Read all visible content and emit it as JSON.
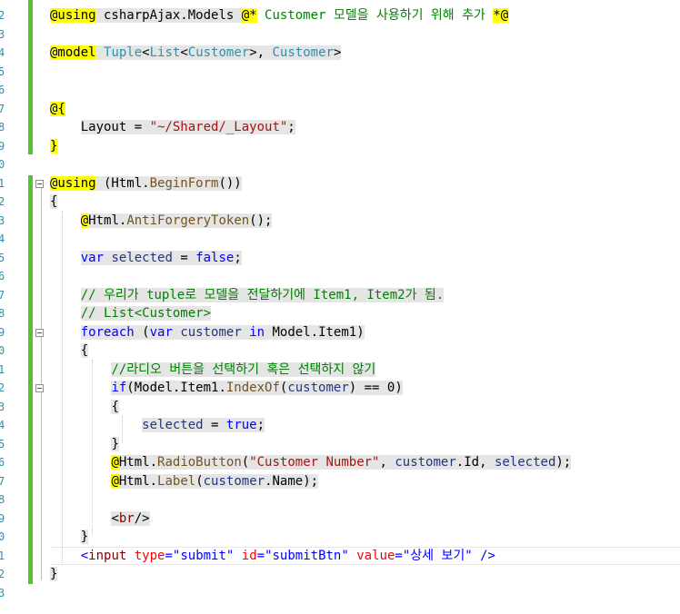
{
  "line_numbers": [
    "2",
    "3",
    "4",
    "5",
    "6",
    "7",
    "8",
    "9",
    "0",
    "1",
    "2",
    "3",
    "4",
    "5",
    "6",
    "7",
    "8",
    "9",
    "0",
    "1",
    "2",
    "3",
    "4",
    "5",
    "6",
    "7",
    "8",
    "9",
    "0",
    "1",
    "2",
    "3"
  ],
  "code_lines": [
    [
      {
        "t": "@using",
        "c": "ye at"
      },
      {
        "t": " csharpAjax.Models ",
        "c": "hl plain"
      },
      {
        "t": "@*",
        "c": "ye at"
      },
      {
        "t": " Customer 모델을 사용하기 위해 추가 ",
        "c": "cm"
      },
      {
        "t": "*@",
        "c": "ye at"
      }
    ],
    [],
    [
      {
        "t": "@model",
        "c": "ye at"
      },
      {
        "t": " ",
        "c": "hl"
      },
      {
        "t": "Tuple",
        "c": "hl ty"
      },
      {
        "t": "<",
        "c": "hl plain"
      },
      {
        "t": "List",
        "c": "hl ty"
      },
      {
        "t": "<",
        "c": "hl plain"
      },
      {
        "t": "Customer",
        "c": "hl ty"
      },
      {
        "t": ">, ",
        "c": "hl plain"
      },
      {
        "t": "Customer",
        "c": "hl ty"
      },
      {
        "t": ">",
        "c": "hl plain"
      }
    ],
    [],
    [],
    [
      {
        "t": "@{",
        "c": "ye at"
      }
    ],
    [
      {
        "t": "    ",
        "c": "plain"
      },
      {
        "t": "Layout = ",
        "c": "hl plain"
      },
      {
        "t": "\"~/Shared/_Layout\"",
        "c": "hl str"
      },
      {
        "t": ";",
        "c": "hl plain"
      }
    ],
    [
      {
        "t": "}",
        "c": "ye at"
      }
    ],
    [],
    [
      {
        "t": "@using",
        "c": "ye at"
      },
      {
        "t": " (Html.",
        "c": "hl plain"
      },
      {
        "t": "BeginForm",
        "c": "hl me"
      },
      {
        "t": "())",
        "c": "hl plain"
      }
    ],
    [
      {
        "t": "{",
        "c": "hl plain"
      }
    ],
    [
      {
        "t": "    ",
        "c": "plain"
      },
      {
        "t": "@",
        "c": "ye at"
      },
      {
        "t": "Html.",
        "c": "hl plain"
      },
      {
        "t": "AntiForgeryToken",
        "c": "hl me"
      },
      {
        "t": "();",
        "c": "hl plain"
      }
    ],
    [],
    [
      {
        "t": "    ",
        "c": "plain"
      },
      {
        "t": "var",
        "c": "hl kw"
      },
      {
        "t": " ",
        "c": "hl"
      },
      {
        "t": "selected",
        "c": "hl pr"
      },
      {
        "t": " = ",
        "c": "hl plain"
      },
      {
        "t": "false",
        "c": "hl kw"
      },
      {
        "t": ";",
        "c": "hl plain"
      }
    ],
    [],
    [
      {
        "t": "    ",
        "c": "plain"
      },
      {
        "t": "// 우리가 tuple로 모델을 전달하기에 Item1, Item2가 됨.",
        "c": "hl cm"
      }
    ],
    [
      {
        "t": "    ",
        "c": "plain"
      },
      {
        "t": "// List<Customer>",
        "c": "hl cm"
      }
    ],
    [
      {
        "t": "    ",
        "c": "plain"
      },
      {
        "t": "foreach",
        "c": "hl kw"
      },
      {
        "t": " (",
        "c": "hl plain"
      },
      {
        "t": "var",
        "c": "hl kw"
      },
      {
        "t": " ",
        "c": "hl"
      },
      {
        "t": "customer",
        "c": "hl pr"
      },
      {
        "t": " ",
        "c": "hl"
      },
      {
        "t": "in",
        "c": "hl kw"
      },
      {
        "t": " Model.Item1)",
        "c": "hl plain"
      }
    ],
    [
      {
        "t": "    ",
        "c": "plain"
      },
      {
        "t": "{",
        "c": "hl plain"
      }
    ],
    [
      {
        "t": "        ",
        "c": "plain"
      },
      {
        "t": "//라디오 버튼을 선택하기 혹은 선택하지 않기",
        "c": "hl cm"
      }
    ],
    [
      {
        "t": "        ",
        "c": "plain"
      },
      {
        "t": "if",
        "c": "hl kw"
      },
      {
        "t": "(Model.Item1.",
        "c": "hl plain"
      },
      {
        "t": "IndexOf",
        "c": "hl me"
      },
      {
        "t": "(",
        "c": "hl plain"
      },
      {
        "t": "customer",
        "c": "hl pr"
      },
      {
        "t": ") == 0)",
        "c": "hl plain"
      }
    ],
    [
      {
        "t": "        ",
        "c": "plain"
      },
      {
        "t": "{",
        "c": "hl plain"
      }
    ],
    [
      {
        "t": "            ",
        "c": "plain"
      },
      {
        "t": "selected",
        "c": "hl pr"
      },
      {
        "t": " = ",
        "c": "hl plain"
      },
      {
        "t": "true",
        "c": "hl kw"
      },
      {
        "t": ";",
        "c": "hl plain"
      }
    ],
    [
      {
        "t": "        ",
        "c": "plain"
      },
      {
        "t": "}",
        "c": "hl plain"
      }
    ],
    [
      {
        "t": "        ",
        "c": "plain"
      },
      {
        "t": "@",
        "c": "ye at"
      },
      {
        "t": "Html.",
        "c": "hl plain"
      },
      {
        "t": "RadioButton",
        "c": "hl me"
      },
      {
        "t": "(",
        "c": "hl plain"
      },
      {
        "t": "\"Customer Number\"",
        "c": "hl str"
      },
      {
        "t": ", ",
        "c": "hl plain"
      },
      {
        "t": "customer",
        "c": "hl pr"
      },
      {
        "t": ".Id, ",
        "c": "hl plain"
      },
      {
        "t": "selected",
        "c": "hl pr"
      },
      {
        "t": ");",
        "c": "hl plain"
      }
    ],
    [
      {
        "t": "        ",
        "c": "plain"
      },
      {
        "t": "@",
        "c": "ye at"
      },
      {
        "t": "Html.",
        "c": "hl plain"
      },
      {
        "t": "Label",
        "c": "hl me"
      },
      {
        "t": "(",
        "c": "hl plain"
      },
      {
        "t": "customer",
        "c": "hl pr"
      },
      {
        "t": ".Name);",
        "c": "hl plain"
      }
    ],
    [],
    [
      {
        "t": "        ",
        "c": "plain"
      },
      {
        "t": "<",
        "c": "hl plain"
      },
      {
        "t": "br",
        "c": "hl tag"
      },
      {
        "t": "/>",
        "c": "hl plain"
      }
    ],
    [
      {
        "t": "    ",
        "c": "plain"
      },
      {
        "t": "}",
        "c": "hl plain"
      }
    ],
    [
      {
        "t": "    ",
        "c": "plain"
      },
      {
        "t": "<",
        "c": "kw"
      },
      {
        "t": "input",
        "c": "tag"
      },
      {
        "t": " ",
        "c": "plain"
      },
      {
        "t": "type",
        "c": "attr"
      },
      {
        "t": "=",
        "c": "kw"
      },
      {
        "t": "\"submit\"",
        "c": "kw"
      },
      {
        "t": " ",
        "c": "plain"
      },
      {
        "t": "id",
        "c": "attr"
      },
      {
        "t": "=",
        "c": "kw"
      },
      {
        "t": "\"submitBtn\"",
        "c": "kw"
      },
      {
        "t": " ",
        "c": "plain"
      },
      {
        "t": "value",
        "c": "attr"
      },
      {
        "t": "=",
        "c": "kw"
      },
      {
        "t": "\"상세 보기\"",
        "c": "kw"
      },
      {
        "t": " />",
        "c": "kw"
      }
    ],
    [
      {
        "t": "}",
        "c": "hl plain"
      }
    ],
    []
  ]
}
